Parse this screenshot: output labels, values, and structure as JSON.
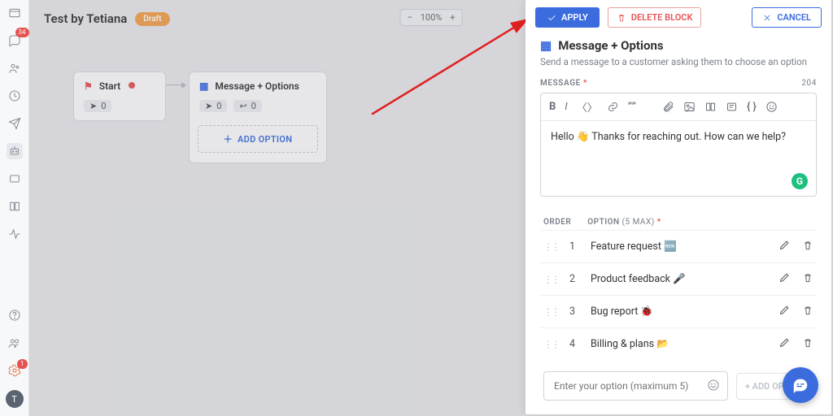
{
  "rail": {
    "badge1": "34",
    "badge2": "1",
    "avatar_initial": "T"
  },
  "header": {
    "title": "Test by Tetiana",
    "status_draft": "Draft",
    "zoom": {
      "minus": "−",
      "value": "100%",
      "plus": "+"
    }
  },
  "canvas": {
    "start": {
      "title": "Start",
      "send_count": "0"
    },
    "msgopt": {
      "title": "Message + Options",
      "send_count": "0",
      "reply_count": "0",
      "add_option": "ADD OPTION"
    }
  },
  "panel": {
    "apply": "APPLY",
    "delete": "DELETE BLOCK",
    "cancel": "CANCEL",
    "title": "Message + Options",
    "subtitle": "Send a message to a customer asking them to choose an option",
    "message_label": "MESSAGE",
    "char_count": "204",
    "message_body": "Hello 👋 Thanks for reaching out. How can we help?",
    "opt_order": "ORDER",
    "opt_option": "OPTION",
    "opt_max": "(5 MAX)",
    "options": [
      {
        "n": "1",
        "text": "Feature request 🆕"
      },
      {
        "n": "2",
        "text": "Product feedback 🎤"
      },
      {
        "n": "3",
        "text": "Bug report 🐞"
      },
      {
        "n": "4",
        "text": "Billing & plans 📂"
      }
    ],
    "option_placeholder": "Enter your option (maximum 5)",
    "add_option_btn": "+   ADD OPTION"
  }
}
